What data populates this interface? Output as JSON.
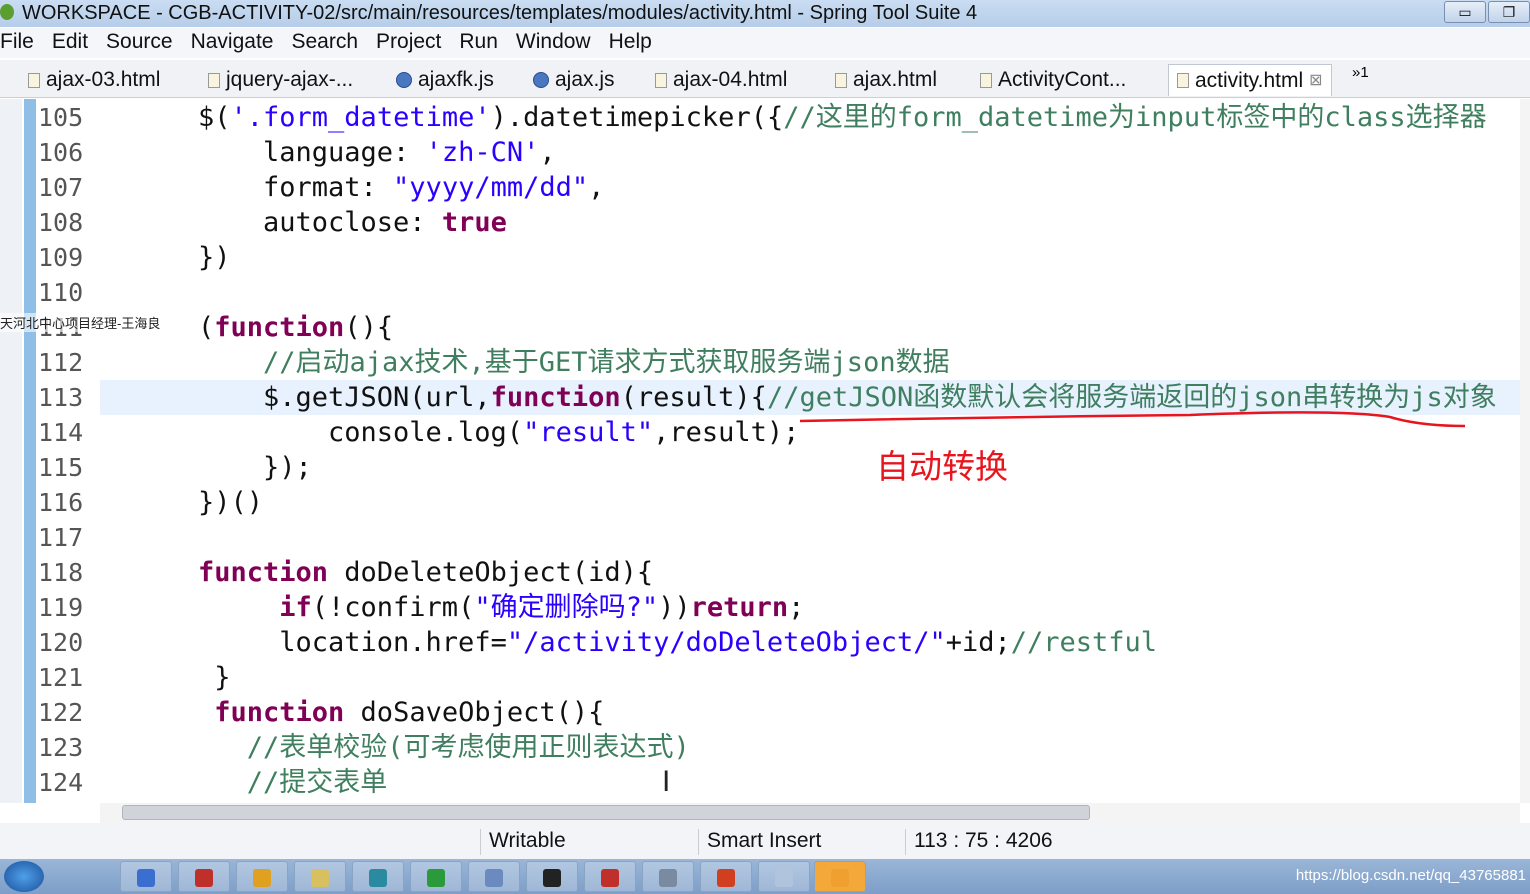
{
  "window": {
    "title": "WORKSPACE - CGB-ACTIVITY-02/src/main/resources/templates/modules/activity.html - Spring Tool Suite 4",
    "minimize": "▭",
    "restore": "❐"
  },
  "menu": [
    "File",
    "Edit",
    "Source",
    "Navigate",
    "Search",
    "Project",
    "Run",
    "Window",
    "Help"
  ],
  "tabs": [
    {
      "label": "ajax-03.html",
      "icon": "html-file-icon"
    },
    {
      "label": "jquery-ajax-...",
      "icon": "html-file-icon"
    },
    {
      "label": "ajaxfk.js",
      "icon": "js-file-icon"
    },
    {
      "label": "ajax.js",
      "icon": "js-file-icon"
    },
    {
      "label": "ajax-04.html",
      "icon": "html-file-icon"
    },
    {
      "label": "ajax.html",
      "icon": "html-file-icon"
    },
    {
      "label": "ActivityCont...",
      "icon": "java-file-icon"
    },
    {
      "label": "activity.html",
      "icon": "html-file-icon",
      "active": true
    }
  ],
  "tab_close": "⊠",
  "tab_overflow": "»1",
  "watermark": "天河北中心项目经理-王海良",
  "annotation": "自动转换",
  "colors": {
    "string": "#2a00ff",
    "keyword": "#7f0055",
    "comment": "#3f7f5f",
    "annotation": "#e8141e",
    "current_line": "#e8f2fe"
  },
  "current_line": 113,
  "code": [
    {
      "n": "105",
      "indent": 0,
      "tokens": [
        [
          "plain",
          "$("
        ],
        [
          "str",
          "'.form_datetime'"
        ],
        [
          "plain",
          ").datetimepicker({"
        ],
        [
          "cmt",
          "//这里的form_datetime为input标签中的class选择器"
        ]
      ]
    },
    {
      "n": "106",
      "indent": 4,
      "tokens": [
        [
          "plain",
          "language: "
        ],
        [
          "str",
          "'zh-CN'"
        ],
        [
          "plain",
          ","
        ]
      ]
    },
    {
      "n": "107",
      "indent": 4,
      "tokens": [
        [
          "plain",
          "format: "
        ],
        [
          "str",
          "\"yyyy/mm/dd\""
        ],
        [
          "plain",
          ","
        ]
      ]
    },
    {
      "n": "108",
      "indent": 4,
      "tokens": [
        [
          "plain",
          "autoclose: "
        ],
        [
          "kw",
          "true"
        ]
      ]
    },
    {
      "n": "109",
      "indent": 0,
      "tokens": [
        [
          "plain",
          "})"
        ]
      ]
    },
    {
      "n": "110",
      "indent": 0,
      "tokens": []
    },
    {
      "n": "111",
      "indent": 0,
      "tokens": [
        [
          "plain",
          "("
        ],
        [
          "kw",
          "function"
        ],
        [
          "plain",
          "(){"
        ]
      ]
    },
    {
      "n": "112",
      "indent": 4,
      "tokens": [
        [
          "cmt",
          "//启动ajax技术,基于GET请求方式获取服务端json数据"
        ]
      ]
    },
    {
      "n": "113",
      "indent": 4,
      "tokens": [
        [
          "plain",
          "$.getJSON(url,"
        ],
        [
          "kw",
          "function"
        ],
        [
          "plain",
          "(result){"
        ],
        [
          "cmt",
          "//getJSON函数默认会将服务端返回的json串转换为js对象"
        ]
      ]
    },
    {
      "n": "114",
      "indent": 8,
      "tokens": [
        [
          "plain",
          "console.log("
        ],
        [
          "str",
          "\"result\""
        ],
        [
          "plain",
          ",result);"
        ]
      ]
    },
    {
      "n": "115",
      "indent": 4,
      "tokens": [
        [
          "plain",
          "});"
        ]
      ]
    },
    {
      "n": "116",
      "indent": 0,
      "tokens": [
        [
          "plain",
          "})()"
        ]
      ]
    },
    {
      "n": "117",
      "indent": 0,
      "tokens": []
    },
    {
      "n": "118",
      "indent": 0,
      "tokens": [
        [
          "kw",
          "function"
        ],
        [
          "plain",
          " doDeleteObject(id){"
        ]
      ]
    },
    {
      "n": "119",
      "indent": 5,
      "tokens": [
        [
          "kw",
          "if"
        ],
        [
          "plain",
          "(!confirm("
        ],
        [
          "str",
          "\"确定删除吗?\""
        ],
        [
          "plain",
          "))"
        ],
        [
          "kw",
          "return"
        ],
        [
          "plain",
          ";"
        ]
      ]
    },
    {
      "n": "120",
      "indent": 5,
      "tokens": [
        [
          "plain",
          "location.href="
        ],
        [
          "str",
          "\"/activity/doDeleteObject/\""
        ],
        [
          "plain",
          "+id;"
        ],
        [
          "cmt",
          "//restful"
        ]
      ]
    },
    {
      "n": "121",
      "indent": 1,
      "tokens": [
        [
          "plain",
          "}"
        ]
      ]
    },
    {
      "n": "122",
      "indent": 1,
      "tokens": [
        [
          "kw",
          "function"
        ],
        [
          "plain",
          " doSaveObject(){"
        ]
      ]
    },
    {
      "n": "123",
      "indent": 3,
      "tokens": [
        [
          "cmt",
          "//表单校验(可考虑使用正则表达式)"
        ]
      ]
    },
    {
      "n": "124",
      "indent": 3,
      "tokens": [
        [
          "cmt",
          "//提交表单"
        ]
      ]
    }
  ],
  "status": {
    "mode": "Writable",
    "insert": "Smart Insert",
    "position": "113 : 75 : 4206"
  },
  "taskbar": {
    "tray_text": "https://blog.csdn.net/qq_43765881"
  }
}
